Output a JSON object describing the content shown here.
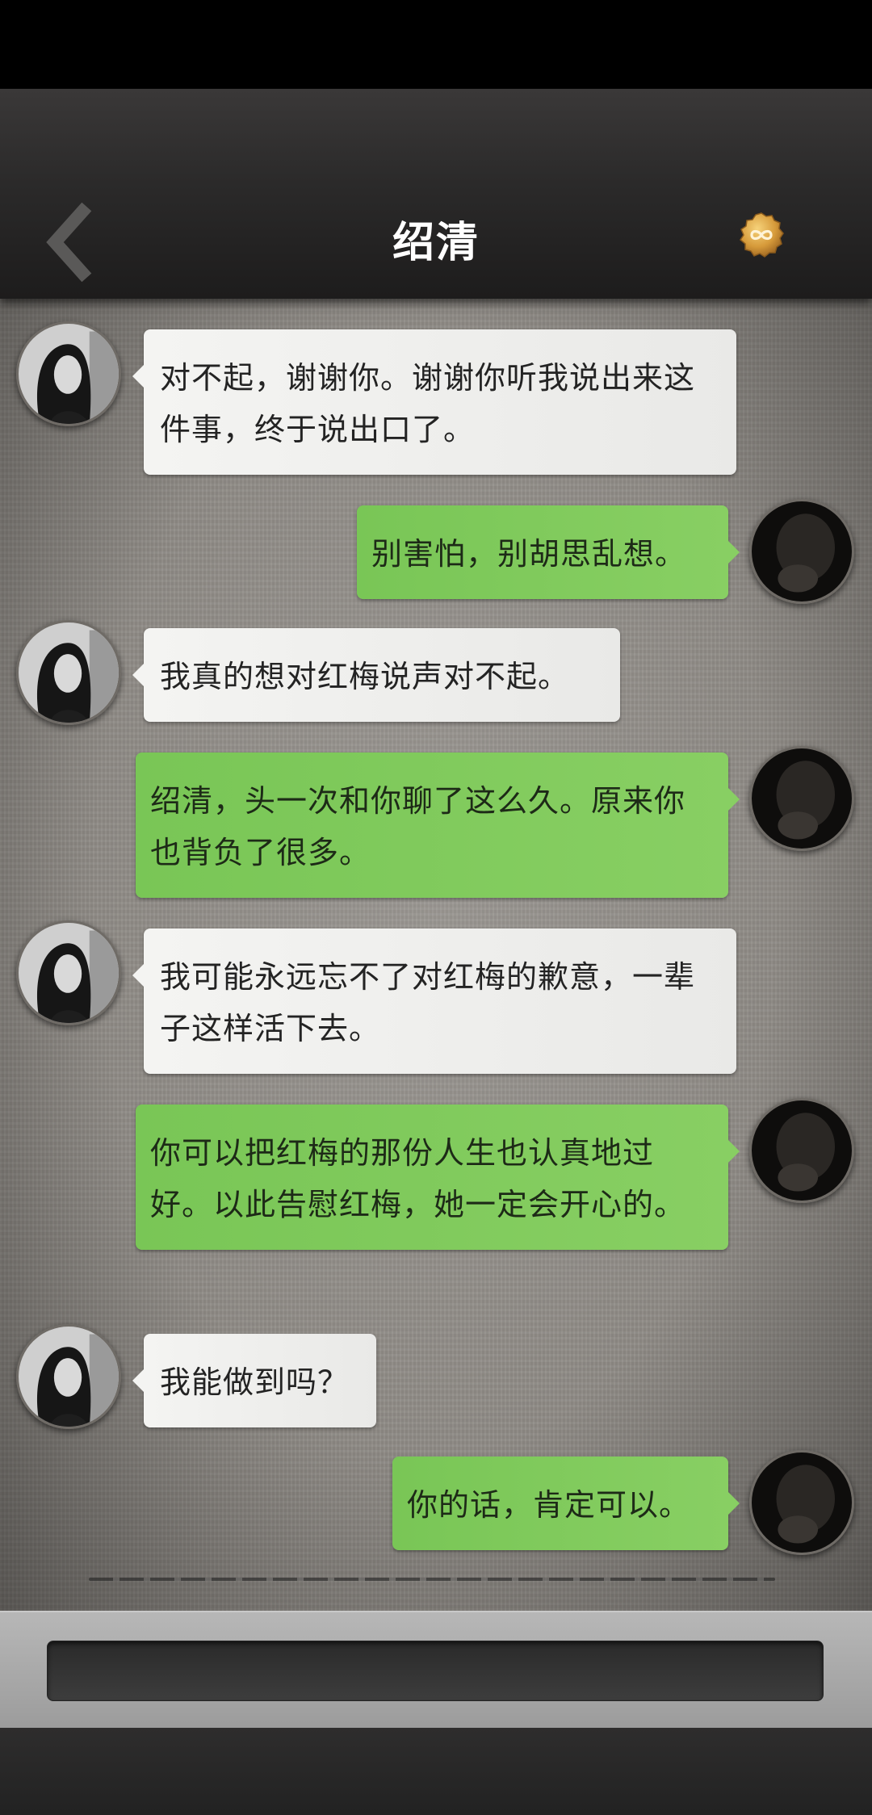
{
  "header": {
    "title": "绍清",
    "back_icon": "chevron-left-icon",
    "coin_icon": "infinity-coin-icon",
    "coin_color": "#d69a3a"
  },
  "colors": {
    "incoming_bubble": "#f4f4f2",
    "outgoing_bubble": "#84cd5f",
    "header_bg": "#2b2a2a",
    "chat_bg": "#8f8b86"
  },
  "messages": [
    {
      "from": "contact",
      "text": "对不起，谢谢你。谢谢你听我说出来这件事，终于说出口了。"
    },
    {
      "from": "me",
      "text": "别害怕，别胡思乱想。"
    },
    {
      "from": "contact",
      "text": "我真的想对红梅说声对不起。"
    },
    {
      "from": "me",
      "text": "绍清，头一次和你聊了这么久。原来你也背负了很多。"
    },
    {
      "from": "contact",
      "text": "我可能永远忘不了对红梅的歉意，一辈子这样活下去。"
    },
    {
      "from": "me",
      "text": "你可以把红梅的那份人生也认真地过好。以此告慰红梅，她一定会开心的。"
    },
    {
      "from": "contact",
      "text": "我能做到吗？"
    },
    {
      "from": "me",
      "text": "你的话，肯定可以。"
    }
  ],
  "input": {
    "value": "",
    "placeholder": ""
  }
}
